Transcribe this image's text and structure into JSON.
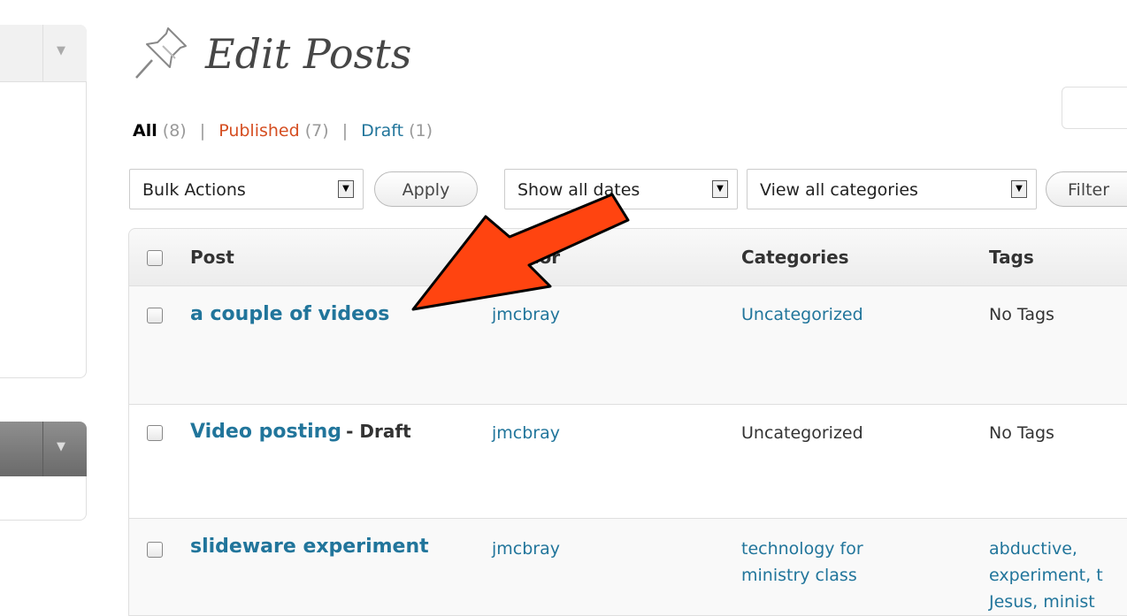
{
  "page": {
    "title": "Edit Posts"
  },
  "filters": {
    "all_label": "All",
    "all_count": "(8)",
    "published_label": "Published",
    "published_count": "(7)",
    "draft_label": "Draft",
    "draft_count": "(1)",
    "separator": "|"
  },
  "toolbar": {
    "bulk_actions": "Bulk Actions",
    "apply": "Apply",
    "dates": "Show all dates",
    "categories": "View all categories",
    "filter": "Filter"
  },
  "table": {
    "columns": {
      "post": "Post",
      "author": "Author",
      "categories": "Categories",
      "tags": "Tags"
    },
    "rows": [
      {
        "title": "a couple of videos",
        "state": "",
        "author": "jmcbray",
        "categories": "Uncategorized",
        "tags": "No Tags"
      },
      {
        "title": "Video posting",
        "state": "- Draft",
        "author": "jmcbray",
        "categories": "Uncategorized",
        "tags": "No Tags"
      },
      {
        "title": "slideware experiment",
        "state": "",
        "author": "jmcbray",
        "categories_line1": "technology for",
        "categories_line2": "ministry class",
        "tags_line1": "abductive,",
        "tags_line2": "experiment, t",
        "tags_line3": "Jesus, minist"
      }
    ]
  },
  "colors": {
    "link": "#21759b",
    "published": "#d54e21",
    "annotation_arrow": "#ff4410"
  },
  "icons": {
    "page": "pushpin-icon",
    "dropdown": "triangle-down-icon"
  }
}
